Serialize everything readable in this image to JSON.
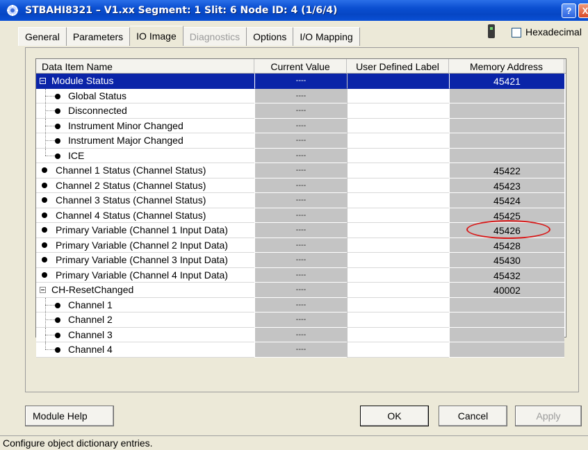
{
  "window": {
    "title": "STBAHI8321 – V1.xx Segment: 1 Slit: 6 Node ID: 4 (1/6/4)",
    "help_glyph": "?",
    "close_glyph": "X"
  },
  "tabs": [
    {
      "label": "General",
      "state": "normal"
    },
    {
      "label": "Parameters",
      "state": "normal"
    },
    {
      "label": "IO Image",
      "state": "active"
    },
    {
      "label": "Diagnostics",
      "state": "disabled"
    },
    {
      "label": "Options",
      "state": "normal"
    },
    {
      "label": "I/O Mapping",
      "state": "normal"
    }
  ],
  "hexadecimal": {
    "label": "Hexadecimal",
    "checked": false
  },
  "table": {
    "headers": [
      "Data Item Name",
      "Current Value",
      "User Defined Label",
      "Memory Address"
    ],
    "rows": [
      {
        "name": "Module Status",
        "kind": "group",
        "value": "----",
        "label": "",
        "address": "45421",
        "selected": true
      },
      {
        "name": "Global Status",
        "kind": "child",
        "value": "----",
        "label": "",
        "address": ""
      },
      {
        "name": "Disconnected",
        "kind": "child",
        "value": "----",
        "label": "",
        "address": ""
      },
      {
        "name": "Instrument Minor Changed",
        "kind": "child",
        "value": "----",
        "label": "",
        "address": ""
      },
      {
        "name": "Instrument Major Changed",
        "kind": "child",
        "value": "----",
        "label": "",
        "address": ""
      },
      {
        "name": "ICE",
        "kind": "child-last",
        "value": "----",
        "label": "",
        "address": ""
      },
      {
        "name": "Channel 1 Status (Channel Status)",
        "kind": "item",
        "value": "----",
        "label": "",
        "address": "45422"
      },
      {
        "name": "Channel 2 Status (Channel Status)",
        "kind": "item",
        "value": "----",
        "label": "",
        "address": "45423"
      },
      {
        "name": "Channel 3 Status (Channel Status)",
        "kind": "item",
        "value": "----",
        "label": "",
        "address": "45424"
      },
      {
        "name": "Channel 4 Status (Channel Status)",
        "kind": "item",
        "value": "----",
        "label": "",
        "address": "45425"
      },
      {
        "name": "Primary Variable (Channel 1 Input Data)",
        "kind": "item",
        "value": "----",
        "label": "",
        "address": "45426"
      },
      {
        "name": "Primary Variable (Channel 2 Input Data)",
        "kind": "item",
        "value": "----",
        "label": "",
        "address": "45428"
      },
      {
        "name": "Primary Variable (Channel 3 Input Data)",
        "kind": "item",
        "value": "----",
        "label": "",
        "address": "45430"
      },
      {
        "name": "Primary Variable (Channel 4 Input Data)",
        "kind": "item",
        "value": "----",
        "label": "",
        "address": "45432"
      },
      {
        "name": "CH-ResetChanged",
        "kind": "group",
        "value": "----",
        "label": "",
        "address": "40002"
      },
      {
        "name": "Channel 1",
        "kind": "child",
        "value": "----",
        "label": "",
        "address": ""
      },
      {
        "name": "Channel 2",
        "kind": "child",
        "value": "----",
        "label": "",
        "address": ""
      },
      {
        "name": "Channel 3",
        "kind": "child",
        "value": "----",
        "label": "",
        "address": ""
      },
      {
        "name": "Channel 4",
        "kind": "child-last",
        "value": "----",
        "label": "",
        "address": ""
      }
    ]
  },
  "buttons": {
    "module_help": "Module Help",
    "ok": "OK",
    "cancel": "Cancel",
    "apply": "Apply"
  },
  "status_bar": "Configure object dictionary entries.",
  "colors": {
    "title_bar": "#0a4ed0",
    "selection": "#0a24a8",
    "readonly_cell": "#c4c4c4",
    "annotation_ellipse": "#d81818"
  }
}
